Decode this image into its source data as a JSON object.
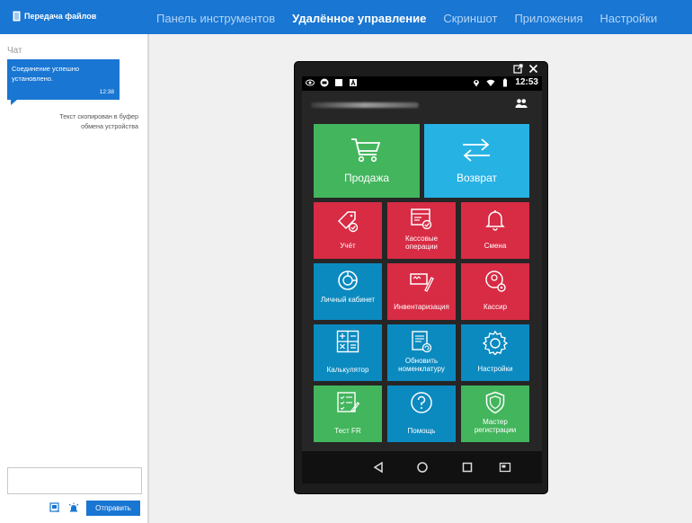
{
  "header": {
    "file_transfer_label": "Передача файлов",
    "nav": [
      {
        "label": "Панель инструментов",
        "active": false
      },
      {
        "label": "Удалённое управление",
        "active": true
      },
      {
        "label": "Скриншот",
        "active": false
      },
      {
        "label": "Приложения",
        "active": false
      },
      {
        "label": "Настройки",
        "active": false
      }
    ]
  },
  "chat": {
    "title": "Чат",
    "message": {
      "text": "Соединение успешно установлено.",
      "time": "12:38"
    },
    "system_message": "Текст скопирован в буфер обмена устройства",
    "input_value": "",
    "send_label": "Отправить",
    "tools": [
      "screenshot-icon",
      "alarm-icon"
    ]
  },
  "device": {
    "status_time": "12:53",
    "status_left_icons": [
      "eye-icon",
      "app-icon",
      "square-icon",
      "a-icon"
    ],
    "status_right_icons": [
      "location-icon",
      "wifi-icon",
      "battery-icon"
    ],
    "tiles": {
      "sale": "Продажа",
      "return": "Возврат",
      "account": "Учёт",
      "cash_ops": "Кассовые операции",
      "shift": "Смена",
      "cabinet": "Личный кабинет",
      "inventory": "Инвентаризация",
      "cashier": "Кассир",
      "calculator": "Калькулятор",
      "update_catalog": "Обновить номенклатуру",
      "settings": "Настройки",
      "test_fr": "Тест FR",
      "help": "Помощь",
      "registration": "Мастер регистрации"
    },
    "navbar": [
      "back-icon",
      "home-icon",
      "recents-icon",
      "screen-icon"
    ]
  },
  "colors": {
    "header": "#1976d2",
    "tile_green": "#43b55d",
    "tile_cyan": "#27b2e4",
    "tile_red": "#d82b44",
    "tile_blue": "#0b8ac0"
  }
}
